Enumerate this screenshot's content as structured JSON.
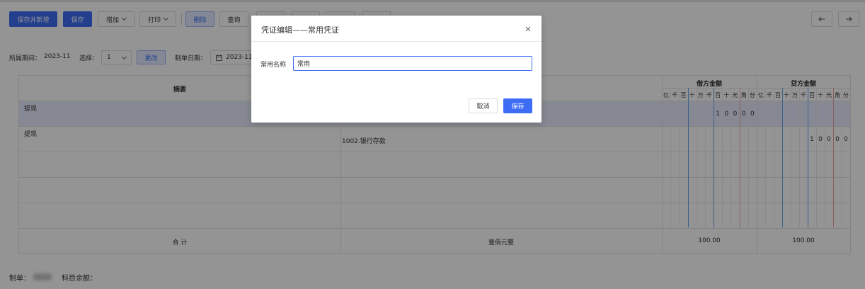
{
  "toolbar": {
    "save_new": "保存并新增",
    "save": "保存",
    "add": "增加",
    "print": "打印",
    "delete": "删除",
    "query": "查询"
  },
  "info": {
    "period_label": "所属期间：",
    "period_value": "2023-11",
    "choose_label": "选择：",
    "choose_value": "1",
    "change_button": "更改",
    "date_label": "制单日期：",
    "date_value": "2023-11-"
  },
  "grid": {
    "col_summary": "摘要",
    "debit_header": "借方金额",
    "credit_header": "贷方金额",
    "digit_units": [
      "亿",
      "千",
      "百",
      "十",
      "万",
      "千",
      "百",
      "十",
      "元",
      "角",
      "分"
    ],
    "rows": [
      {
        "summary": "提现",
        "account": "",
        "debit_digits": [
          "1",
          "0",
          "0",
          "0",
          "0"
        ],
        "credit_digits": []
      },
      {
        "summary": "提现",
        "account": "1002.银行存款",
        "debit_digits": [],
        "credit_digits": [
          "1",
          "0",
          "0",
          "0",
          "0"
        ]
      }
    ],
    "total_label": "合 计",
    "total_words": "壹佰元整",
    "total_debit": "100.00",
    "total_credit": "100.00"
  },
  "footer": {
    "maker_label": "制单：",
    "balance_label": "科目余额："
  },
  "dialog": {
    "title": "凭证编辑——常用凭证",
    "name_label": "常用名称",
    "name_value": "常用",
    "cancel": "取消",
    "save": "保存"
  },
  "colors": {
    "primary": "#3d6df5",
    "selected_row": "#e7ecfd",
    "separator_blue": "#6ea5e8",
    "separator_red": "#f0a5a5"
  }
}
